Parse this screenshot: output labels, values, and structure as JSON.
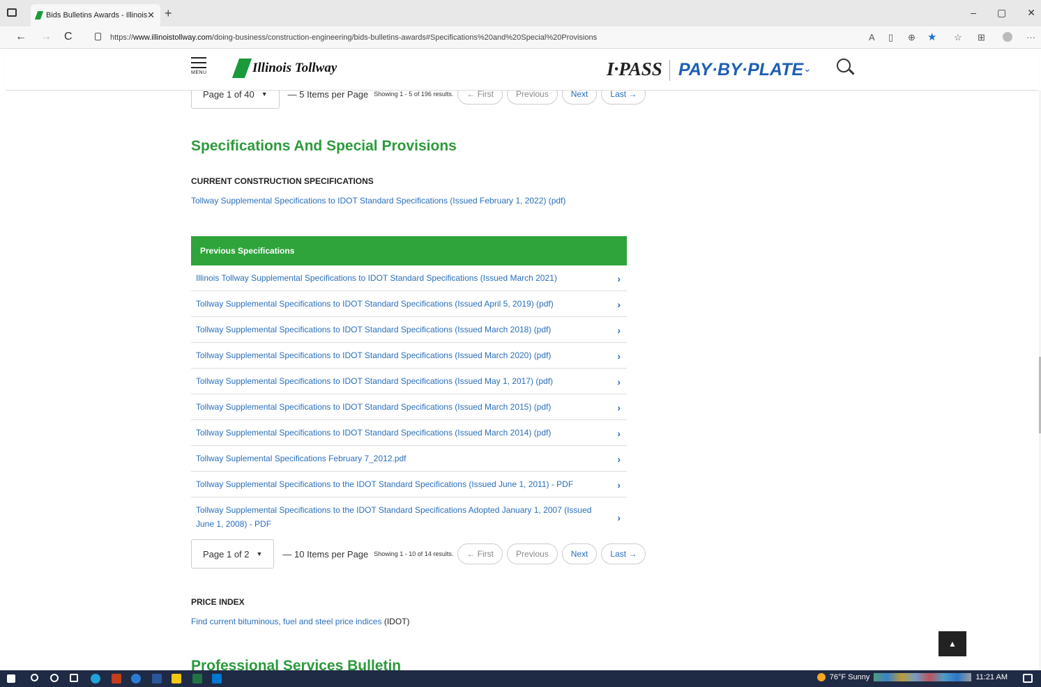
{
  "browser": {
    "tab_title": "Bids Bulletins Awards - Illinois To",
    "tab_close": "✕",
    "new_tab": "+",
    "url_prefix": "https://",
    "url_host": "www.illinoistollway.com",
    "url_path": "/doing-business/construction-engineering/bids-bulletins-awards#Specifications%20and%20Special%20Provisions",
    "back": "←",
    "forward": "→",
    "refresh": "C",
    "win_min": "–",
    "win_max": "▢",
    "win_close": "✕",
    "more": "···"
  },
  "header": {
    "menu_label": "MENU",
    "logo_text": "Illinois Tollway",
    "ipass": "I·PASS",
    "pay_by_plate": "PAY·BY·PLATE",
    "pbp_chevron": "⌄"
  },
  "top_pager": {
    "page_select": "Page 1 of 40",
    "items_per_page": "— 5 Items per Page",
    "showing": "Showing 1 - 5 of 196 results.",
    "first": "← First",
    "previous": "Previous",
    "next": "Next",
    "last": "Last →"
  },
  "section": {
    "heading": "Specifications And Special Provisions",
    "current_label": "CURRENT CONSTRUCTION SPECIFICATIONS",
    "current_link": "Tollway Supplemental Specifications to IDOT Standard Specifications (Issued February 1, 2022) (pdf)"
  },
  "previous_specs": {
    "header": "Previous Specifications",
    "items": [
      "Illinois Tollway Supplemental Specifications to IDOT Standard Specifications (Issued March 2021)",
      "Tollway Supplemental Specifications to IDOT Standard Specifications (Issued April 5, 2019) (pdf)",
      "Tollway Supplemental Specifications to IDOT Standard Specifications (Issued March 2018) (pdf)",
      "Tollway Supplemental Specifications to IDOT Standard Specifications (Issued March 2020) (pdf)",
      "Tollway Supplemental Specifications to IDOT Standard Specifications (Issued May 1, 2017) (pdf)",
      "Tollway Supplemental Specifications to IDOT Standard Specifications (Issued March 2015) (pdf)",
      "Tollway Supplemental Specifications to IDOT Standard Specifications (Issued March 2014) (pdf)",
      "Tollway Suplemental Specifications February 7_2012.pdf",
      "Tollway Supplemental Specifications to the IDOT Standard Specifications (Issued June 1, 2011) - PDF",
      "Tollway Supplemental Specifications to the IDOT Standard Specifications Adopted January 1, 2007 (Issued June 1, 2008) - PDF"
    ],
    "chevron": "›"
  },
  "bottom_pager": {
    "page_select": "Page 1 of 2",
    "items_per_page": "— 10 Items per Page",
    "showing": "Showing 1 - 10 of 14 results.",
    "first": "← First",
    "previous": "Previous",
    "next": "Next",
    "last": "Last →"
  },
  "price_index": {
    "label": "PRICE INDEX",
    "link": "Find current bituminous, fuel and steel price indices",
    "suffix": " (IDOT)"
  },
  "next_heading": "Professional Services Bulletin",
  "back_to_top": "▲",
  "taskbar": {
    "weather": "76°F  Sunny",
    "time": "11:21 AM"
  }
}
